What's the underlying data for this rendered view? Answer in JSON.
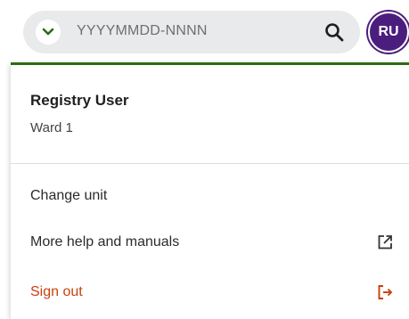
{
  "search": {
    "placeholder": "YYYYMMDD-NNNN"
  },
  "avatar": {
    "initials": "RU",
    "color": "#4b1e7e"
  },
  "menu": {
    "user_name": "Registry User",
    "unit": "Ward 1",
    "items": [
      {
        "label": "Change unit",
        "icon": ""
      },
      {
        "label": "More help and manuals",
        "icon": "external-link-icon"
      },
      {
        "label": "Sign out",
        "icon": "sign-out-icon",
        "color": "#c8410e"
      }
    ],
    "accent_color": "#2e6b12"
  }
}
